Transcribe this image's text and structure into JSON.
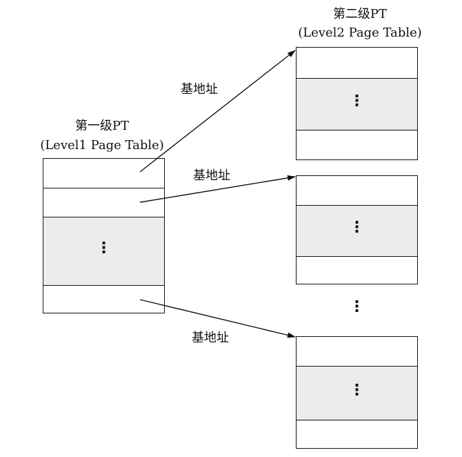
{
  "level1": {
    "title_line1": "第一级PT",
    "title_line2": "(Level1 Page Table)",
    "ellipsis": "⋮"
  },
  "level2": {
    "title_line1": "第二级PT",
    "title_line2": "(Level2 Page Table)",
    "ellipsis": "⋮"
  },
  "between_tables_ellipsis": "⋮",
  "arrows": [
    {
      "label": "基地址"
    },
    {
      "label": "基地址"
    },
    {
      "label": "基地址"
    }
  ]
}
